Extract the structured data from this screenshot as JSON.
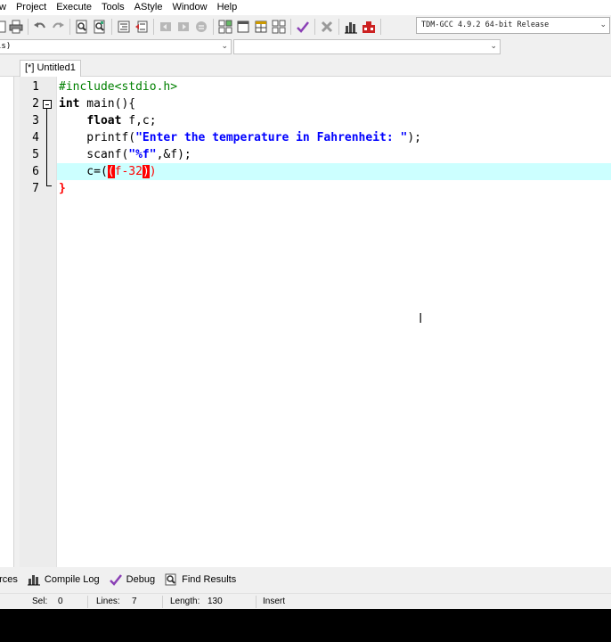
{
  "menu": {
    "items": [
      "w",
      "Project",
      "Execute",
      "Tools",
      "AStyle",
      "Window",
      "Help"
    ]
  },
  "toolbar": {
    "compiler": "TDM-GCC 4.9.2 64-bit Release"
  },
  "classbar": {
    "classes_value": "ls)",
    "members_value": ""
  },
  "tabs": {
    "active_label": "[*] Untitled1"
  },
  "editor": {
    "line_numbers": [
      "1",
      "2",
      "3",
      "4",
      "5",
      "6",
      "7"
    ],
    "lines": {
      "l1": "#include<stdio.h>",
      "l2_kw": "int",
      "l2_rest": " main(){",
      "l3_indent": "    ",
      "l3_kw": "float",
      "l3_rest": " f,c;",
      "l4_pre": "    printf(",
      "l4_str": "\"Enter the temperature in Fahrenheit: \"",
      "l4_post": ");",
      "l5_pre": "    scanf(",
      "l5_str": "\"%f\"",
      "l5_post": ",&f);",
      "l6_pre": "    c=(",
      "l6_open": "(",
      "l6_mid": "f-32",
      "l6_close": ")",
      "l6_post": ")",
      "l7": "}"
    }
  },
  "bottom_tabs": {
    "resources": "urces",
    "compile_log": "Compile Log",
    "debug": "Debug",
    "find_results": "Find Results"
  },
  "status": {
    "sel_label": "Sel:",
    "sel_value": "0",
    "lines_label": "Lines:",
    "lines_value": "7",
    "length_label": "Length:",
    "length_value": "130",
    "mode": "Insert"
  },
  "colors": {
    "current_line": "#ccffff",
    "keyword": "#000000",
    "preprocessor": "#008000",
    "string": "#0000ff",
    "symbol": "#ff0000",
    "brace_match_bg": "#ff0000"
  }
}
